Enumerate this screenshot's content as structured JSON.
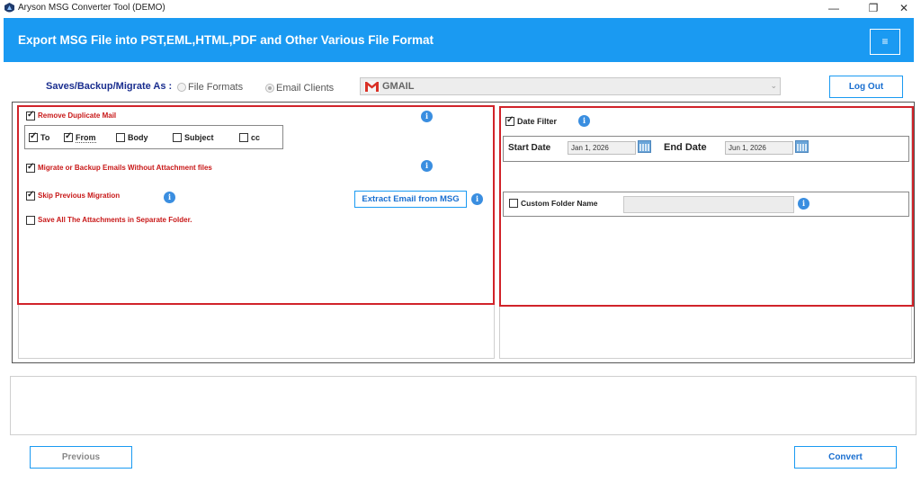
{
  "window": {
    "title": "Aryson MSG Converter Tool (DEMO)",
    "minimize": "—",
    "restore": "❐",
    "close": "✕"
  },
  "banner": {
    "title": "Export MSG File into PST,EML,HTML,PDF and Other Various File Format",
    "menu_icon": "≡"
  },
  "saves": {
    "label": "Saves/Backup/Migrate As :",
    "options": [
      "File Formats",
      "Email Clients"
    ],
    "selected": "Email Clients",
    "client_value": "GMAIL",
    "client_icon": "gmail-icon",
    "dropdown_arrow": "⌄"
  },
  "logout_label": "Log Out",
  "left_panel": {
    "remove_duplicate": {
      "label": "Remove Duplicate Mail",
      "checked": true
    },
    "filters": [
      {
        "label": "To",
        "checked": true
      },
      {
        "label": "From",
        "checked": true
      },
      {
        "label": "Body",
        "checked": false
      },
      {
        "label": "Subject",
        "checked": false
      },
      {
        "label": "cc",
        "checked": false
      }
    ],
    "without_attachment": {
      "label": "Migrate or Backup Emails Without Attachment files",
      "checked": true
    },
    "skip_previous": {
      "label": "Skip Previous Migration",
      "checked": true
    },
    "save_attachments": {
      "label": "Save All The Attachments in Separate Folder.",
      "checked": false
    },
    "extract_button": "Extract Email from MSG"
  },
  "right_panel": {
    "date_filter": {
      "label": "Date Filter",
      "checked": true
    },
    "start_date_label": "Start Date",
    "start_date_value": "Jan 1, 2026",
    "end_date_label": "End Date",
    "end_date_value": "Jun 1, 2026",
    "custom_folder": {
      "label": "Custom Folder Name",
      "checked": false,
      "value": ""
    }
  },
  "info_glyph": "i",
  "buttons": {
    "previous": "Previous",
    "convert": "Convert"
  },
  "colors": {
    "banner": "#1a9af2",
    "highlight": "#d1232a",
    "label_red": "#c81818",
    "label_blue": "#1a2e8f"
  }
}
